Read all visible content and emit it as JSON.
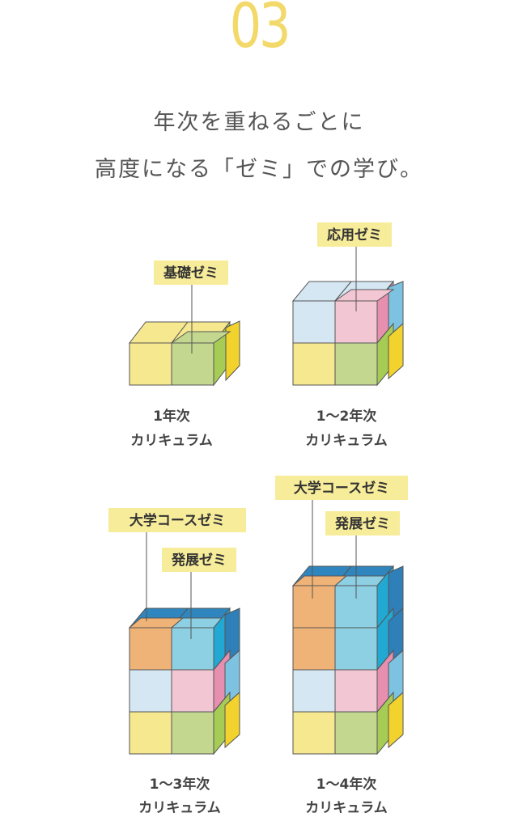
{
  "step_number": "03",
  "headline": {
    "line1": "年次を重ねるごとに",
    "line2": "高度になる「ゼミ」での学び。"
  },
  "colors": {
    "accent_yellow": "#f3d96a",
    "label_bg": "#f7ec9a",
    "yellow_cube": "#f6e88f",
    "green_cube": "#c3d88e",
    "light_blue_cube": "#d5e7f3",
    "pink_cube": "#f3c6d4",
    "orange_cube": "#f0b377",
    "cyan_cube": "#8dcfe3",
    "blue_top": "#2f86bf"
  },
  "diagrams": [
    {
      "tags": [
        "基礎ゼミ"
      ],
      "caption": {
        "line1": "1年次",
        "line2": "カリキュラム"
      }
    },
    {
      "tags": [
        "応用ゼミ"
      ],
      "caption": {
        "line1": "1〜2年次",
        "line2": "カリキュラム"
      }
    },
    {
      "tags": [
        "大学コースゼミ",
        "発展ゼミ"
      ],
      "caption": {
        "line1": "1〜3年次",
        "line2": "カリキュラム"
      }
    },
    {
      "tags": [
        "大学コースゼミ",
        "発展ゼミ"
      ],
      "caption": {
        "line1": "1〜4年次",
        "line2": "カリキュラム"
      }
    }
  ]
}
